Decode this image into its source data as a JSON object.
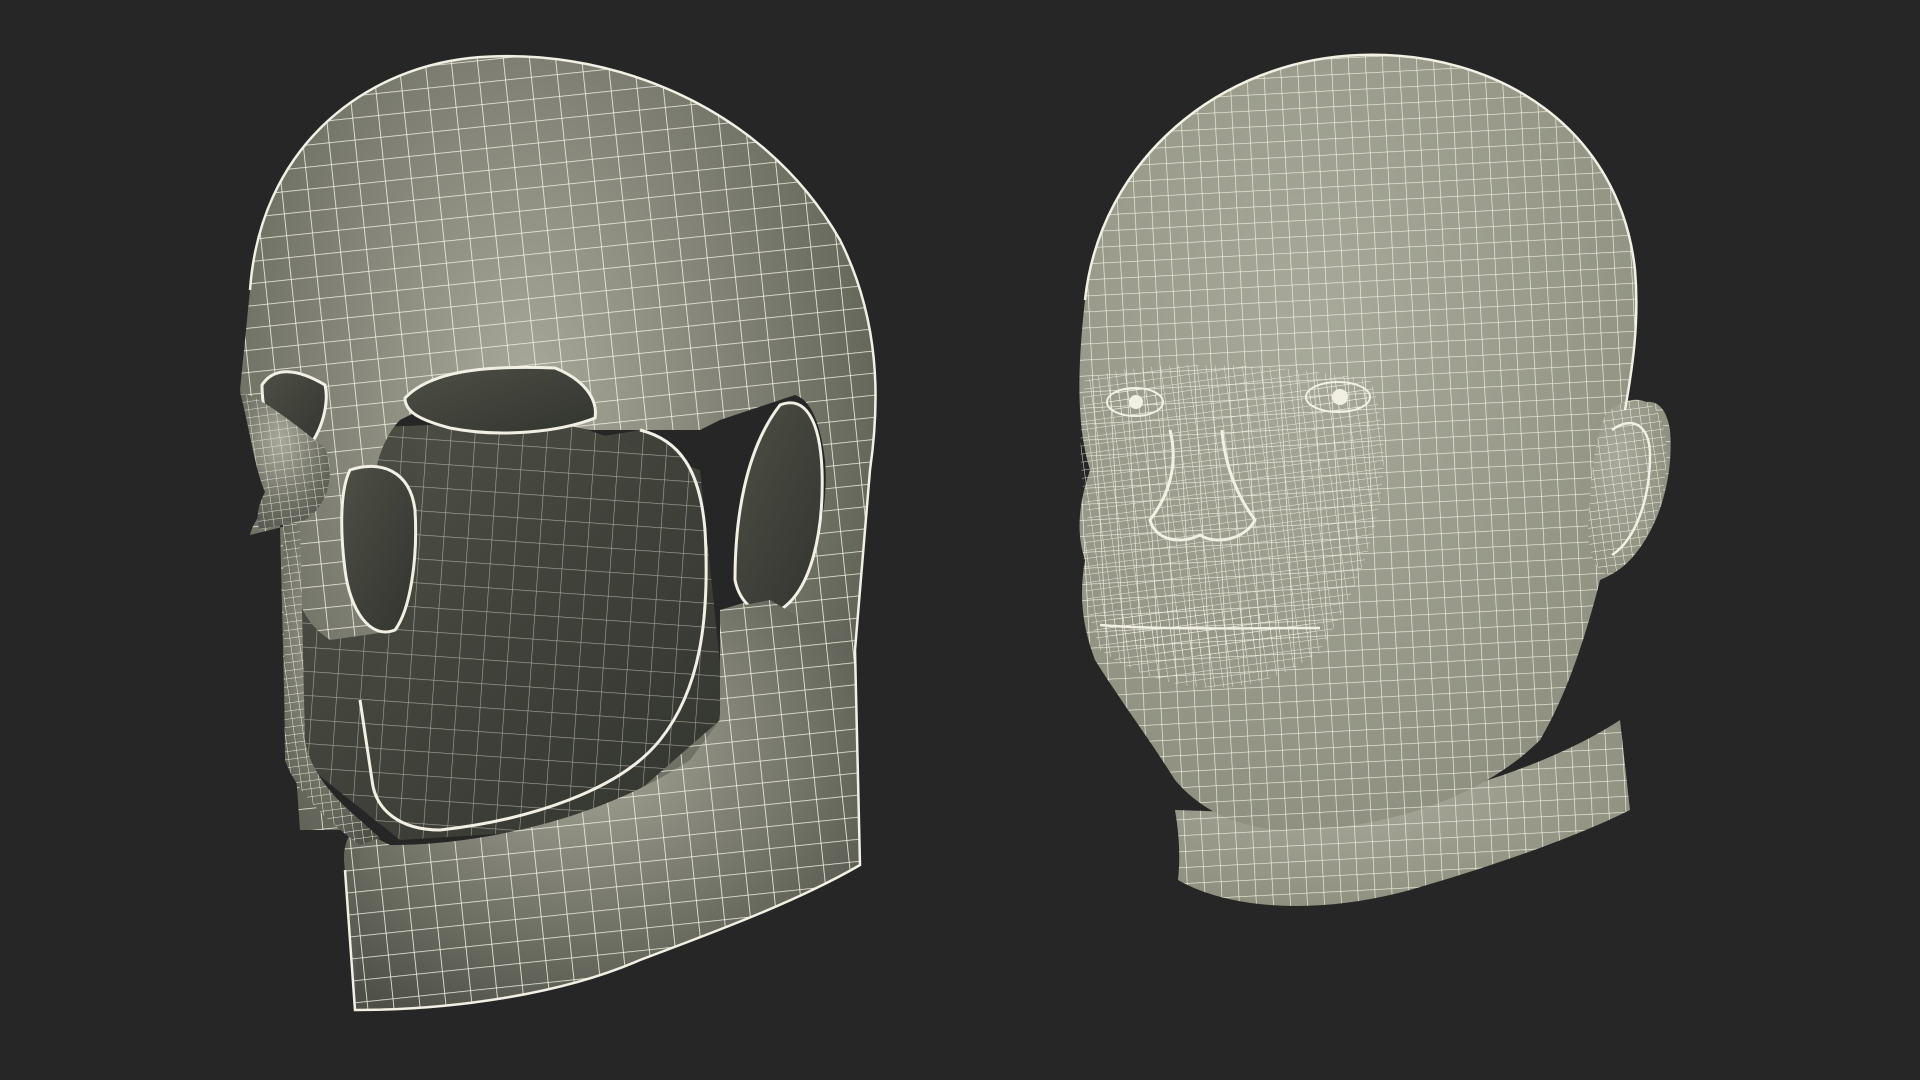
{
  "scene": {
    "background_color": "#262626",
    "mesh_fill_color": "#8a8b7b",
    "mesh_shadow_color": "#4e4f45",
    "mesh_highlight_color": "#a8a99a",
    "interior_color": "#32342f",
    "wire_color": "#f2f0e4",
    "objects": [
      {
        "name": "balaclava-mask-mesh"
      },
      {
        "name": "human-head-mesh"
      }
    ]
  }
}
